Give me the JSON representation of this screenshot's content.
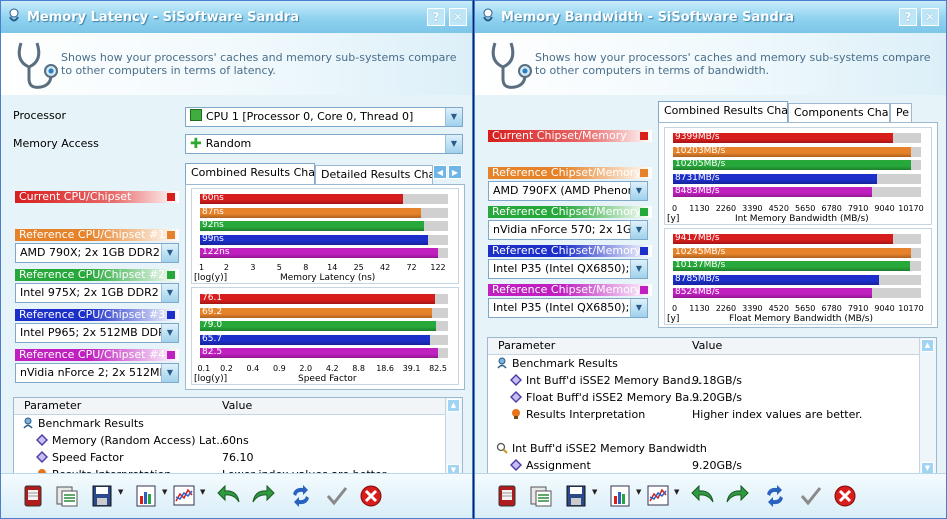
{
  "left": {
    "title": "Memory Latency - SiSoftware Sandra",
    "help_btn": "?",
    "close_btn": "✕",
    "description": "Shows how your processors' caches and memory sub-systems compare to other computers in terms of latency.",
    "processor_label": "Processor",
    "processor_value": "CPU 1 [Processor 0, Core 0, Thread 0]",
    "memory_access_label": "Memory Access",
    "memory_access_value": "Random",
    "tabs": [
      "Combined Results Chart",
      "Detailed Results Chart"
    ],
    "current_label": "Current CPU/Chipset",
    "references": [
      {
        "label": "Reference CPU/Chipset #1",
        "value": "AMD 790X; 2x 1GB DDR2 DIM",
        "color": "#e6832a"
      },
      {
        "label": "Reference CPU/Chipset #2",
        "value": "Intel 975X; 2x 1GB DDR2 DIM",
        "color": "#27a83a"
      },
      {
        "label": "Reference CPU/Chipset #3",
        "value": "Intel P965; 2x 512MB DDR2 D",
        "color": "#1c2fc9"
      },
      {
        "label": "Reference CPU/Chipset #4",
        "value": "nVidia nForce 2; 2x 512MB DD",
        "color": "#c020c0"
      }
    ],
    "list_headers": [
      "Parameter",
      "Value"
    ],
    "list_rows": [
      {
        "icon": "benchmark-icon",
        "indent": 0,
        "name": "Benchmark Results",
        "value": ""
      },
      {
        "icon": "diamond-icon",
        "indent": 1,
        "name": "Memory (Random Access) Lat...",
        "value": "60ns"
      },
      {
        "icon": "diamond-icon",
        "indent": 1,
        "name": "Speed Factor",
        "value": "76.10"
      },
      {
        "icon": "bulb-icon",
        "indent": 1,
        "name": "Results Interpretation",
        "value": "Lower index values are better."
      }
    ]
  },
  "right": {
    "title": "Memory Bandwidth - SiSoftware Sandra",
    "help_btn": "?",
    "close_btn": "✕",
    "description": "Shows how your processors' caches and memory sub-systems compare to other computers in terms of bandwidth.",
    "tabs": [
      "Combined Results Chart",
      "Components Chart",
      "Pe"
    ],
    "current_label": "Current Chipset/Memory",
    "references": [
      {
        "label": "Reference Chipset/Memory",
        "value": "AMD 790FX (AMD Phenom 97",
        "color": "#e6832a"
      },
      {
        "label": "Reference Chipset/Memory",
        "value": "nVidia nForce 570; 2x 1GB DD",
        "color": "#27a83a"
      },
      {
        "label": "Reference Chipset/Memory",
        "value": "Intel P35 (Intel QX6850); 2x",
        "color": "#1c2fc9"
      },
      {
        "label": "Reference Chipset/Memory",
        "value": "Intel P35 (Intel QX6850); 2x",
        "color": "#c020c0"
      }
    ],
    "list_headers": [
      "Parameter",
      "Value"
    ],
    "list_rows": [
      {
        "icon": "benchmark-icon",
        "indent": 0,
        "name": "Benchmark Results",
        "value": ""
      },
      {
        "icon": "diamond-icon",
        "indent": 1,
        "name": "Int Buff'd iSSE2 Memory Band...",
        "value": "9.18GB/s"
      },
      {
        "icon": "diamond-icon",
        "indent": 1,
        "name": "Float Buff'd iSSE2 Memory Ba...",
        "value": "9.20GB/s"
      },
      {
        "icon": "bulb-icon",
        "indent": 1,
        "name": "Results Interpretation",
        "value": "Higher index values are better."
      },
      {
        "icon": "",
        "indent": 0,
        "name": "",
        "value": ""
      },
      {
        "icon": "search-icon",
        "indent": 0,
        "name": "Int Buff'd iSSE2 Memory Bandwidth",
        "value": ""
      },
      {
        "icon": "diamond-icon",
        "indent": 1,
        "name": "Assignment",
        "value": "9.20GB/s"
      }
    ]
  },
  "colors": {
    "current": "#d81d1d",
    "ref1": "#e6832a",
    "ref2": "#27a83a",
    "ref3": "#1c2fc9",
    "ref4": "#c020c0"
  },
  "chart_data": [
    {
      "type": "bar",
      "orientation": "horizontal",
      "xlabel": "Memory Latency (ns)",
      "scale_note": "[log(y)]",
      "x_ticks": [
        "1",
        "2",
        "3",
        "5",
        "8",
        "14",
        "25",
        "42",
        "72",
        "122"
      ],
      "xlim": [
        1,
        122
      ],
      "log_scale": true,
      "categories": [
        "Current CPU/Chipset",
        "Reference CPU/Chipset #1",
        "Reference CPU/Chipset #2",
        "Reference CPU/Chipset #3",
        "Reference CPU/Chipset #4"
      ],
      "values": [
        60,
        87,
        92,
        99,
        122
      ],
      "labels": [
        "60ns",
        "87ns",
        "92ns",
        "99ns",
        "122ns"
      ]
    },
    {
      "type": "bar",
      "orientation": "horizontal",
      "xlabel": "Speed Factor",
      "scale_note": "[log(y)]",
      "x_ticks": [
        "0.1",
        "0.2",
        "0.4",
        "0.9",
        "2.0",
        "4.2",
        "8.8",
        "18.6",
        "39.1",
        "82.5"
      ],
      "xlim": [
        0.1,
        82.5
      ],
      "log_scale": true,
      "categories": [
        "Current CPU/Chipset",
        "Reference CPU/Chipset #1",
        "Reference CPU/Chipset #2",
        "Reference CPU/Chipset #3",
        "Reference CPU/Chipset #4"
      ],
      "values": [
        76.1,
        69.2,
        79.0,
        65.7,
        82.5
      ],
      "labels": [
        "76.1",
        "69.2",
        "79.0",
        "65.7",
        "82.5"
      ]
    },
    {
      "type": "bar",
      "orientation": "horizontal",
      "xlabel": "Int Memory Bandwidth (MB/s)",
      "scale_note": "[y]",
      "x_ticks": [
        "0",
        "1130",
        "2260",
        "3390",
        "4520",
        "5650",
        "6780",
        "7910",
        "9040",
        "10170"
      ],
      "xlim": [
        0,
        10170
      ],
      "log_scale": false,
      "categories": [
        "Current Chipset/Memory",
        "Reference 1",
        "Reference 2",
        "Reference 3",
        "Reference 4"
      ],
      "values": [
        9399,
        10203,
        10205,
        8731,
        8483
      ],
      "labels": [
        "9399MB/s",
        "10203MB/s",
        "10205MB/s",
        "8731MB/s",
        "8483MB/s"
      ]
    },
    {
      "type": "bar",
      "orientation": "horizontal",
      "xlabel": "Float Memory Bandwidth (MB/s)",
      "scale_note": "[y]",
      "x_ticks": [
        "0",
        "1130",
        "2260",
        "3390",
        "4520",
        "5650",
        "6780",
        "7910",
        "9040",
        "10170"
      ],
      "xlim": [
        0,
        10170
      ],
      "log_scale": false,
      "categories": [
        "Current Chipset/Memory",
        "Reference 1",
        "Reference 2",
        "Reference 3",
        "Reference 4"
      ],
      "values": [
        9417,
        10245,
        10137,
        8785,
        8524
      ],
      "labels": [
        "9417MB/s",
        "10245MB/s",
        "10137MB/s",
        "8785MB/s",
        "8524MB/s"
      ]
    }
  ],
  "toolbar": [
    "cpu-icon",
    "report-icon",
    "save-icon",
    "chart-options-icon",
    "graph-icon",
    "back-icon",
    "forward-icon",
    "refresh-icon",
    "ok-icon",
    "cancel-icon"
  ]
}
